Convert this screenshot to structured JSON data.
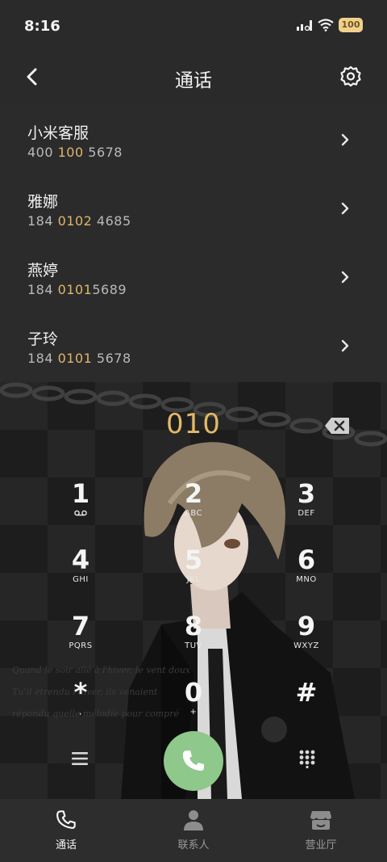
{
  "status_bar": {
    "time": "8:16",
    "battery": "100",
    "icons": [
      "signal-icon",
      "wifi-icon",
      "battery-icon"
    ]
  },
  "header": {
    "title": "通话",
    "back_icon": "back-arrow-icon",
    "settings_icon": "gear-icon"
  },
  "results": [
    {
      "name": "小米客服",
      "number_parts": [
        "400 ",
        "100",
        " 5678"
      ]
    },
    {
      "name": "雅娜",
      "number_parts": [
        "184 ",
        "0102",
        " 4685"
      ]
    },
    {
      "name": "燕婷",
      "number_parts": [
        "184 ",
        "0101",
        "5689"
      ]
    },
    {
      "name": "子玲",
      "number_parts": [
        "184 ",
        "0101",
        " 5678"
      ]
    }
  ],
  "dialer": {
    "input": "010",
    "keys": [
      {
        "digit": "1",
        "letters": ""
      },
      {
        "digit": "2",
        "letters": "ABC"
      },
      {
        "digit": "3",
        "letters": "DEF"
      },
      {
        "digit": "4",
        "letters": "GHI"
      },
      {
        "digit": "5",
        "letters": "JKL"
      },
      {
        "digit": "6",
        "letters": "MNO"
      },
      {
        "digit": "7",
        "letters": "PQRS"
      },
      {
        "digit": "8",
        "letters": "TUV"
      },
      {
        "digit": "9",
        "letters": "WXYZ"
      },
      {
        "digit": "*",
        "letters": ","
      },
      {
        "digit": "0",
        "letters": "+"
      },
      {
        "digit": "#",
        "letters": ""
      }
    ]
  },
  "nav": [
    {
      "label": "通话",
      "icon": "phone-icon",
      "active": true
    },
    {
      "label": "联系人",
      "icon": "contact-icon",
      "active": false
    },
    {
      "label": "营业厅",
      "icon": "store-icon",
      "active": false
    }
  ],
  "colors": {
    "background": "#2a2a2a",
    "highlight": "#e0b66a",
    "call_button": "#8ec88b",
    "battery": "#f1d08a"
  }
}
